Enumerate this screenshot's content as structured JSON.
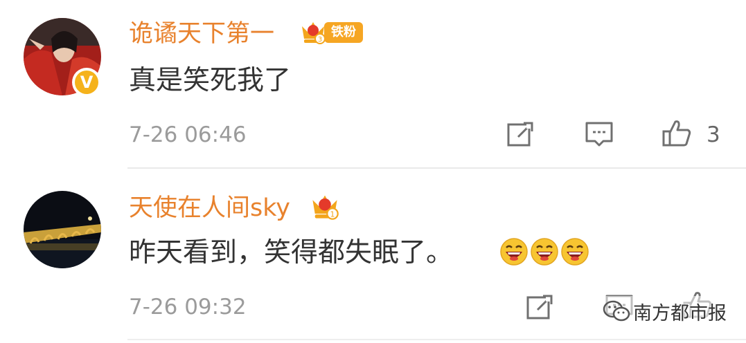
{
  "comments": [
    {
      "username": "诡谲天下第一",
      "fan_badge": "铁粉",
      "fan_level": "3",
      "text": "真是笑死我了",
      "timestamp": "7-26 06:46",
      "likes": "3",
      "verified_mark": "V",
      "avatar": "avatar-woman-red-costume",
      "crown_icon": "crown-fan-icon"
    },
    {
      "username": "天使在人间sky",
      "fan_level": "1",
      "text": "昨天看到，笑得都失眠了。",
      "emojis": [
        "laughing-emoji",
        "laughing-emoji",
        "laughing-emoji"
      ],
      "timestamp": "7-26 09:32",
      "avatar": "avatar-bridge-night",
      "crown_icon": "crown-fan-icon"
    }
  ],
  "watermark": {
    "text": "南方都市报",
    "icon": "wechat-icon"
  },
  "colors": {
    "username": "#e8822d",
    "text": "#333333",
    "meta": "#9b9b9b",
    "badge": "#f6a623",
    "verified": "#f5b21b"
  }
}
